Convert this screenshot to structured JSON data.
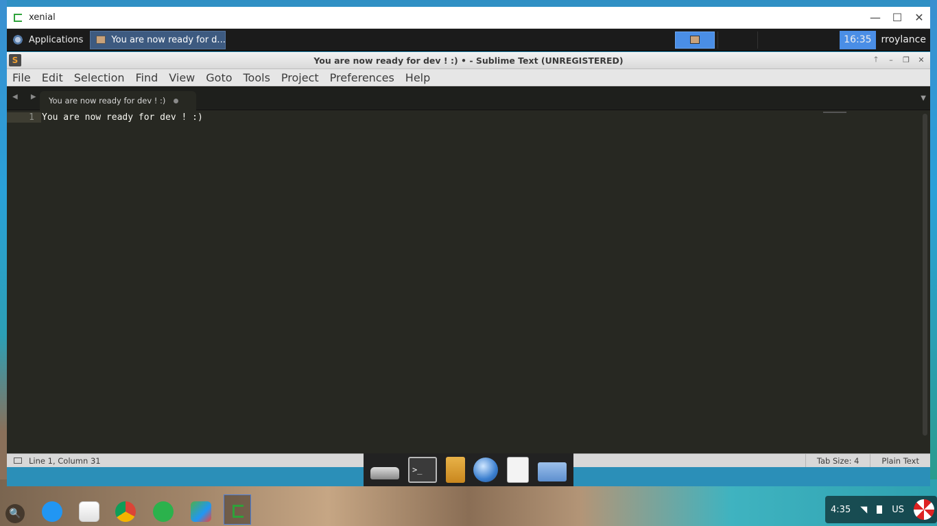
{
  "outer_window": {
    "title": "xenial",
    "minimize": "—",
    "maximize": "☐",
    "close": "✕"
  },
  "xfce_panel": {
    "applications_label": "Applications",
    "task_button_label": "You are now ready for d...",
    "clock": "16:35",
    "user": "rroylance"
  },
  "sublime": {
    "window_title": "You are now ready for dev ! :) • - Sublime Text (UNREGISTERED)",
    "icon_letter": "S",
    "title_controls": {
      "up": "🡑",
      "minimize": "–",
      "restore": "❐",
      "close": "✕"
    },
    "menu": [
      "File",
      "Edit",
      "Selection",
      "Find",
      "View",
      "Goto",
      "Tools",
      "Project",
      "Preferences",
      "Help"
    ],
    "tab": {
      "label": "You are now ready for dev ! :)",
      "nav": "◀ ▶",
      "dropdown": "▼"
    },
    "editor": {
      "line_number": "1",
      "line_text": "You are now ready for dev ! :)"
    },
    "status": {
      "position": "Line 1, Column 31",
      "tab_size": "Tab Size: 4",
      "syntax": "Plain Text"
    }
  },
  "dock": {
    "terminal_glyph": ">_"
  },
  "shelf": {
    "launcher_glyph": "🔍",
    "time": "4:35",
    "wifi_glyph": "◥",
    "keyboard": "US"
  },
  "colors": {
    "editor_bg": "#272822",
    "panel_bg": "#1b1b1b",
    "accent_blue": "#4a8ee6",
    "terminal_green": "#2ea23a"
  }
}
